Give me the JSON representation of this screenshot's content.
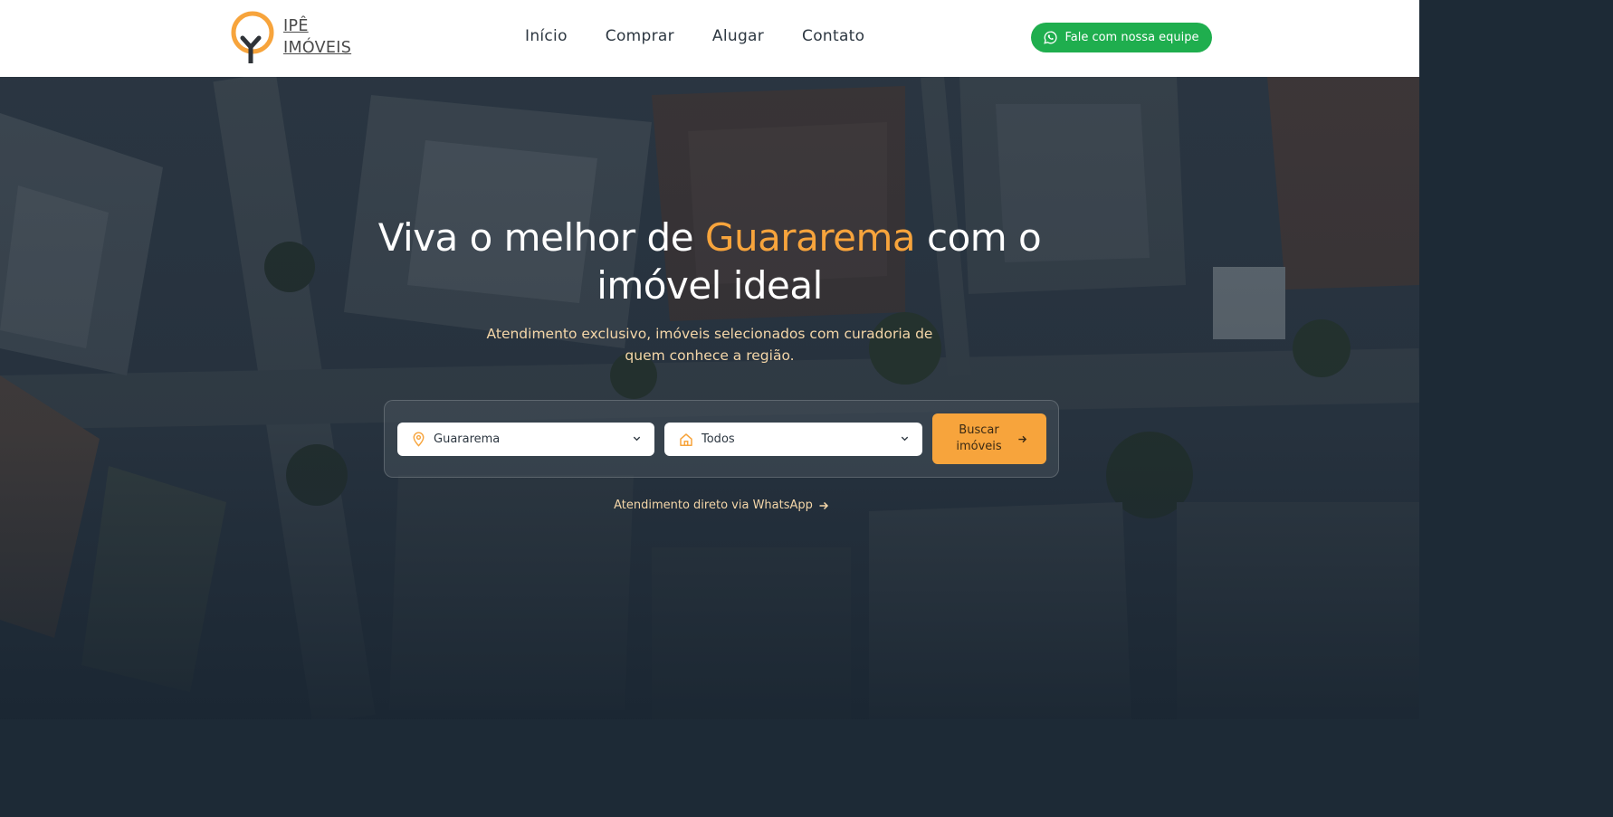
{
  "brand": {
    "name_line1": "IPÊ",
    "name_line2": "IMÓVEIS",
    "accent_color": "#f7a43c"
  },
  "nav": {
    "items": [
      {
        "label": "Início"
      },
      {
        "label": "Comprar"
      },
      {
        "label": "Alugar"
      },
      {
        "label": "Contato"
      }
    ]
  },
  "header": {
    "cta_label": "Fale com nossa equipe",
    "cta_color": "#1fae4e"
  },
  "hero": {
    "title_pre": "Viva o melhor de ",
    "title_accent": "Guararema",
    "title_post": " com o",
    "title_line2": "imóvel ideal",
    "subtitle": "Atendimento exclusivo, imóveis selecionados com curadoria de quem conhece a região."
  },
  "search": {
    "city_value": "Guararema",
    "type_value": "Todos",
    "button_label": "Buscar imóveis"
  },
  "whatsapp_link": "Atendimento direto via WhatsApp"
}
